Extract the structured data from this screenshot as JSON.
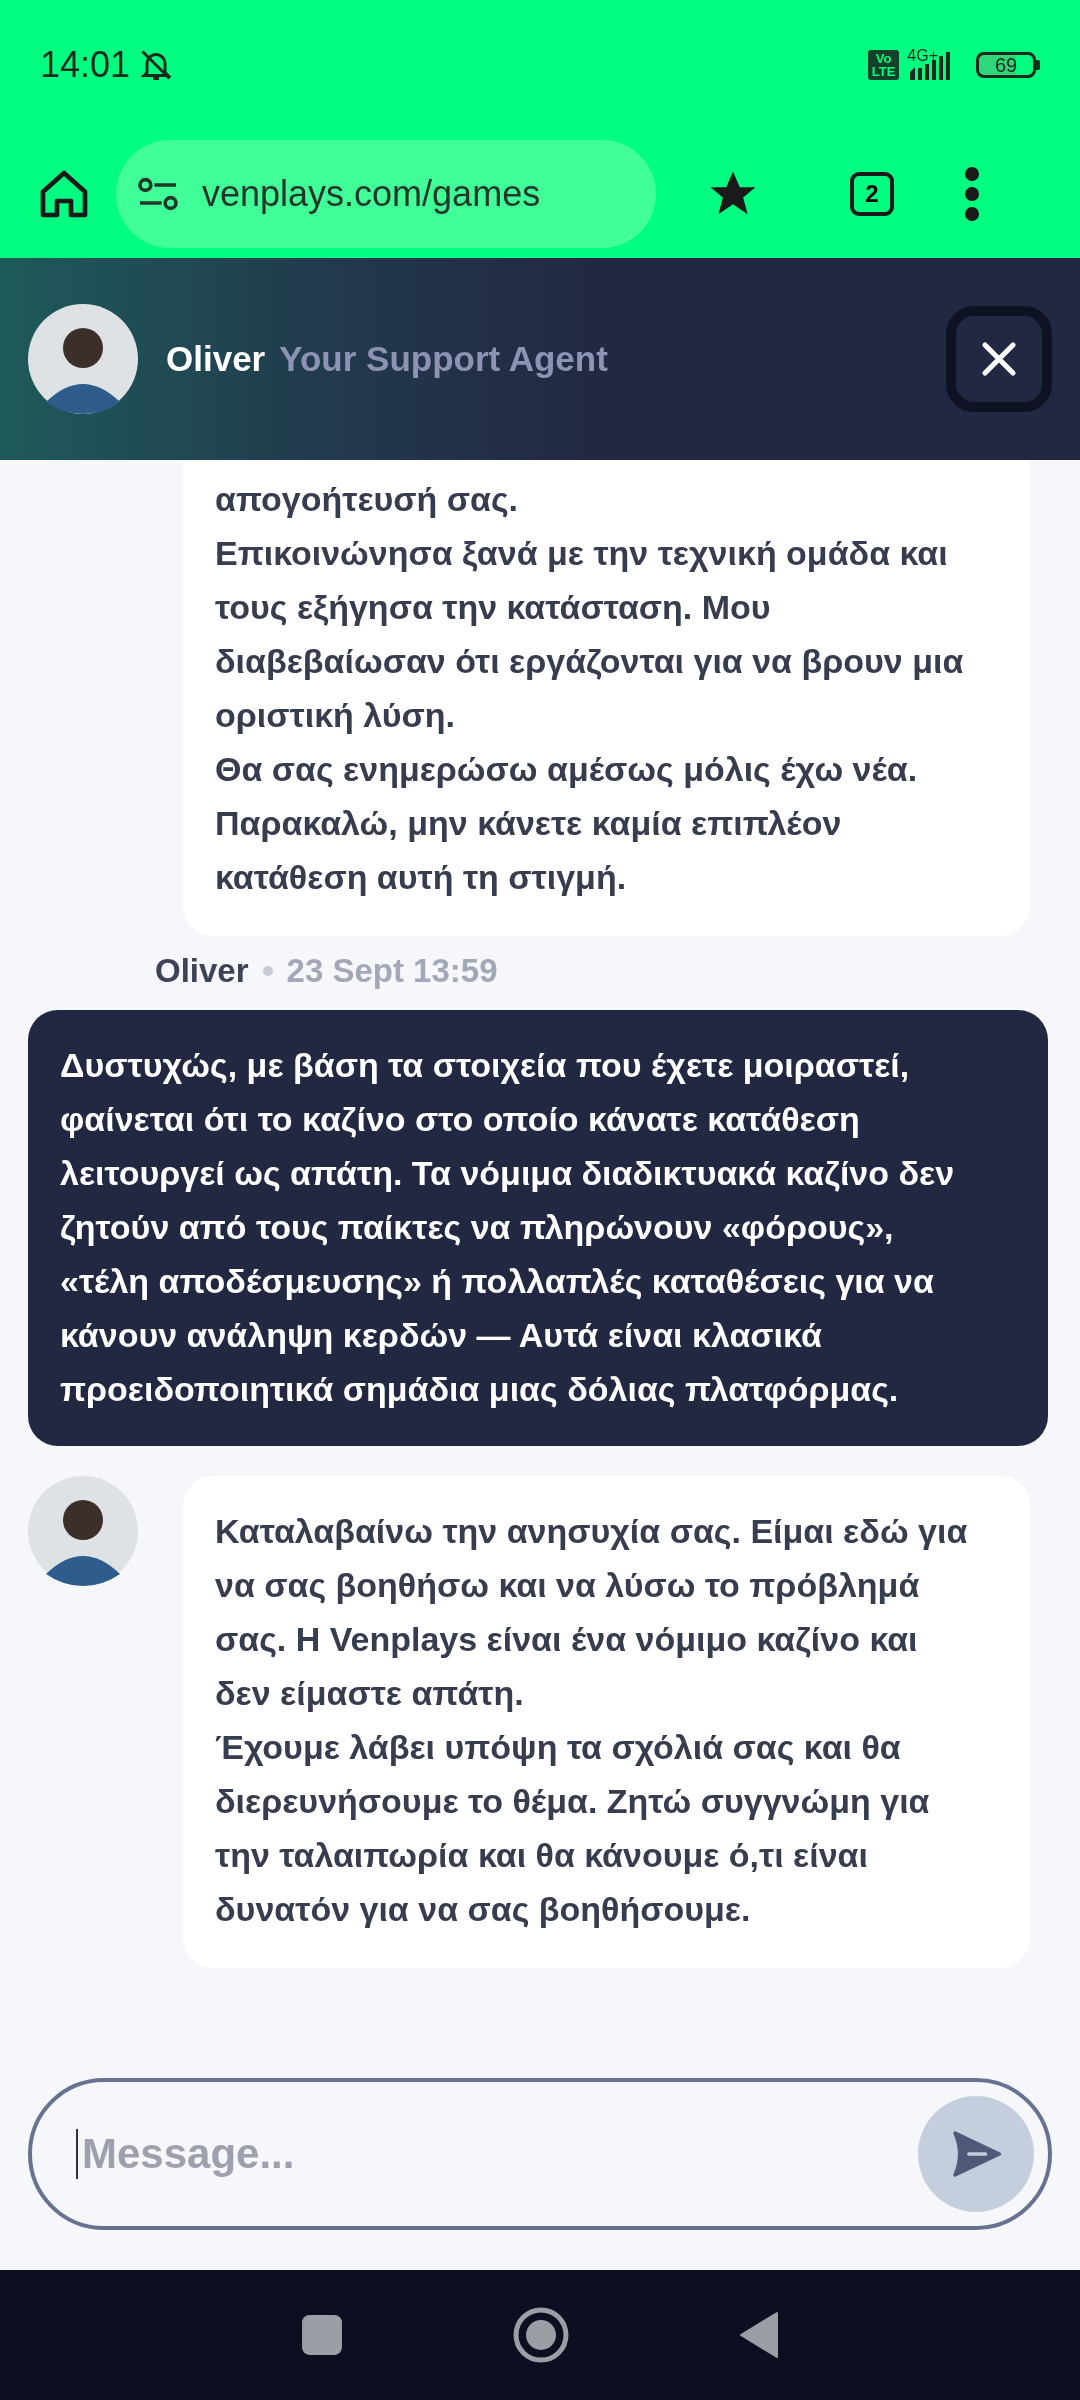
{
  "status_bar": {
    "time": "14:01",
    "volte": [
      "Vo",
      "LTE"
    ],
    "network": "4G+",
    "battery": "69"
  },
  "browser": {
    "url": "venplays.com/games",
    "tab_count": "2"
  },
  "chat_header": {
    "agent_name": "Oliver",
    "agent_role": "Your Support Agent"
  },
  "messages": [
    {
      "kind": "agent",
      "show_avatar": false,
      "continued": true,
      "paragraphs": [
        "απογοήτευσή σας.",
        "Επικοινώνησα ξανά με την τεχνική ομάδα και τους εξήγησα την κατάσταση. Μου διαβεβαίωσαν ότι εργάζονται για να βρουν μια οριστική λύση.",
        "Θα σας ενημερώσω αμέσως μόλις έχω νέα. Παρακαλώ, μην κάνετε καμία επιπλέον κατάθεση αυτή τη στιγμή."
      ],
      "author": "Oliver",
      "time": "23 Sept 13:59"
    },
    {
      "kind": "user",
      "paragraphs": [
        "Δυστυχώς, με βάση τα στοιχεία που έχετε μοιραστεί, φαίνεται ότι το καζίνο στο οποίο κάνατε κατάθεση λειτουργεί ως απάτη. Τα νόμιμα διαδικτυακά καζίνο δεν ζητούν από τους παίκτες να πληρώνουν «φόρους», «τέλη αποδέσμευσης» ή πολλαπλές καταθέσεις για να κάνουν ανάληψη κερδών — Αυτά είναι κλασικά προειδοποιητικά σημάδια μιας δόλιας πλατφόρμας."
      ]
    },
    {
      "kind": "agent",
      "show_avatar": true,
      "continued": false,
      "paragraphs": [
        "Καταλαβαίνω την ανησυχία σας. Είμαι εδώ για να σας βοηθήσω και να λύσω το πρόβλημά σας. Η Venplays είναι ένα νόμιμο καζίνο και δεν είμαστε απάτη.",
        "Έχουμε λάβει υπόψη τα σχόλιά σας και θα διερευνήσουμε το θέμα. Ζητώ συγγνώμη για την ταλαιπωρία και θα κάνουμε ό,τι είναι δυνατόν για να σας βοηθήσουμε."
      ]
    }
  ],
  "composer": {
    "placeholder": "Message..."
  }
}
